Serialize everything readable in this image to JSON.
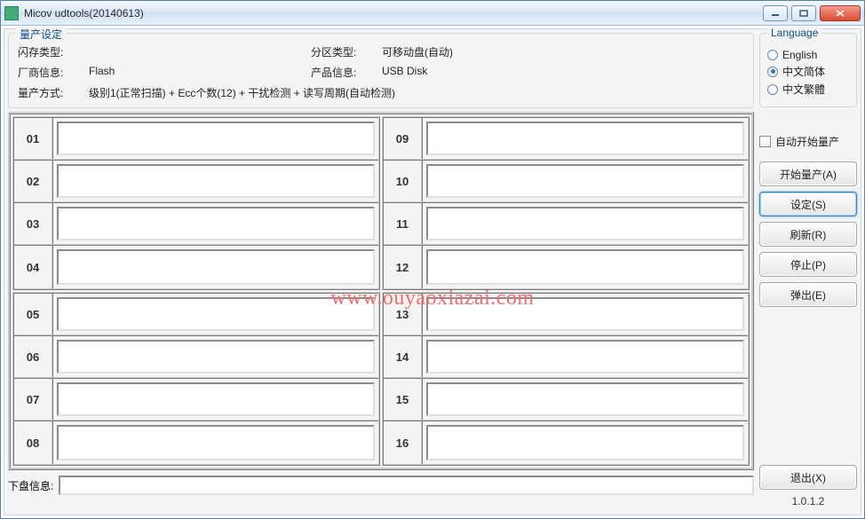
{
  "window": {
    "title": "Micov udtools(20140613)"
  },
  "settings": {
    "legend": "量产设定",
    "flash_type_label": "闪存类型:",
    "flash_type_value": "",
    "partition_type_label": "分区类型:",
    "partition_type_value": "可移动盘(自动)",
    "vendor_label": "厂商信息:",
    "vendor_value": "Flash",
    "product_label": "产品信息:",
    "product_value": "USB Disk",
    "mode_label": "量产方式:",
    "mode_value": "级别1(正常扫描) + Ecc个数(12) + 干扰检测 + 读写周期(自动检测)"
  },
  "slots": [
    "01",
    "02",
    "03",
    "04",
    "05",
    "06",
    "07",
    "08",
    "09",
    "10",
    "11",
    "12",
    "13",
    "14",
    "15",
    "16"
  ],
  "bottom": {
    "label": "下盘信息:"
  },
  "lang": {
    "legend": "Language",
    "options": [
      {
        "label": "English",
        "checked": false
      },
      {
        "label": "中文简体",
        "checked": true
      },
      {
        "label": "中文繁體",
        "checked": false
      }
    ]
  },
  "auto_start": {
    "label": "自动开始量产",
    "checked": false
  },
  "buttons": {
    "start": "开始量产(A)",
    "settings": "设定(S)",
    "refresh": "刷新(R)",
    "stop": "停止(P)",
    "eject": "弹出(E)",
    "exit": "退出(X)"
  },
  "version": "1.0.1.2",
  "watermark": "www.ouyaoxiazai.com"
}
